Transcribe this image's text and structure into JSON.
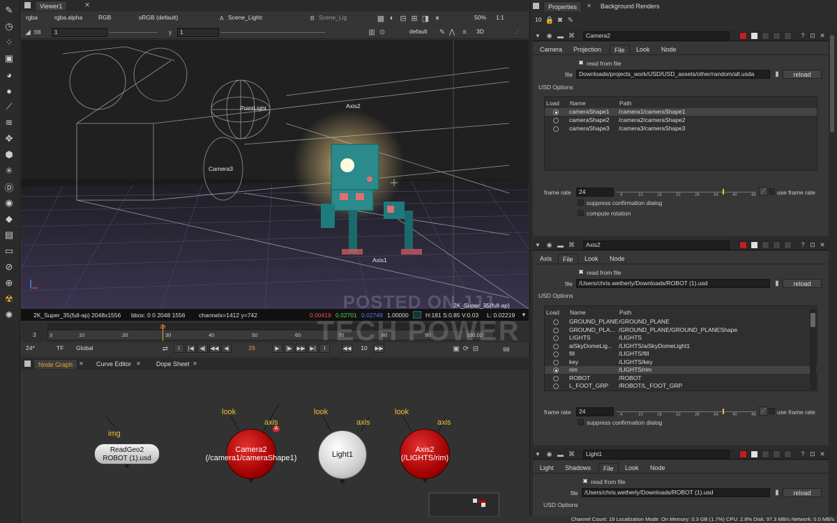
{
  "viewer": {
    "tab": "Viewer1",
    "channels": "rgba",
    "alpha": "rgba.alpha",
    "rgb": "RGB",
    "colorspace": "sRGB (default)",
    "input_a_letter": "A",
    "input_a": "Scene_Lights",
    "input_b_letter": "B",
    "input_b": "Scene_Lig",
    "zoom": "50%",
    "ratio": "1:1",
    "fstop": "f/8",
    "gain": "1",
    "gamma_label": "y",
    "gamma": "1",
    "lut": "default",
    "view_mode": "3D",
    "labels": {
      "pointlight": "PointLight",
      "axis2": "Axis2",
      "camera3": "Camera3",
      "axis1": "Axis1",
      "format": "2K_Super_35(full-ap)"
    },
    "info": {
      "format": "2K_Super_35(full-ap) 2048x1556",
      "bbox": "bbox: 0 0 2048 1556",
      "channel": "channel:",
      "coords": "x=1412 y=742",
      "r": "0.00419",
      "g": "0.02701",
      "b": "0.02749",
      "a": "1.00000",
      "hsv": "H:181 S:0.85 V:0.03",
      "l": "L: 0.02219",
      "colors": {
        "r": "#ff4b4b",
        "g": "#52d952",
        "b": "#5a78ff",
        "a": "#ffffff"
      }
    }
  },
  "timeline": {
    "frame_start": "3",
    "frame_end": "98",
    "current": "29",
    "step": "10",
    "fps": "24*",
    "tf": "TF",
    "scope": "Global",
    "ticks": [
      "3",
      "10",
      "20",
      "30",
      "40",
      "50",
      "60",
      "70",
      "80",
      "90",
      "100"
    ],
    "marker": "29",
    "end_marker": "100.02"
  },
  "bottom_tabs": [
    "Node Graph",
    "Curve Editor",
    "Dope Sheet"
  ],
  "nodes": {
    "readgeo": {
      "line1": "ReadGeo2",
      "line2": "ROBOT (1).usd",
      "input": "img"
    },
    "camera": {
      "line1": "Camera2",
      "line2": "(/camera1/cameraShape1)",
      "look": "look",
      "axis": "axis",
      "badge": "A"
    },
    "light": {
      "line1": "Light1",
      "look": "look",
      "axis": "axis"
    },
    "axis": {
      "line1": "Axis2",
      "line2": "(/LIGHTS/rim)",
      "look": "look",
      "axis": "axis"
    }
  },
  "properties": {
    "tabs": [
      "Properties",
      "Background Renders"
    ],
    "max_panels": "10",
    "camera_panel": {
      "name": "Camera2",
      "tabs": [
        "Camera",
        "Projection",
        "File",
        "Look",
        "Node"
      ],
      "active_tab": "File",
      "read_from_file": "read from file",
      "file_label": "file",
      "file_path": "Downloads/projects_work/USD/USD_assets/other/random/all.usda",
      "reload": "reload",
      "usd_options": "USD Options",
      "col_load": "Load",
      "col_name": "Name",
      "col_path": "Path",
      "rows": [
        {
          "name": "cameraShape1",
          "path": "/camera1/cameraShape1",
          "on": true
        },
        {
          "name": "cameraShape2",
          "path": "/camera2/cameraShape2",
          "on": false
        },
        {
          "name": "cameraShape3",
          "path": "/camera3/cameraShape3",
          "on": false
        }
      ],
      "frame_rate_label": "frame rate",
      "frame_rate": "24",
      "slider_ticks": [
        "4",
        "10",
        "16",
        "22",
        "28",
        "34",
        "40",
        "46"
      ],
      "use_frame_rate": "use frame rate",
      "suppress": "suppress confirmation dialog",
      "compute_rotation": "compute rotation"
    },
    "axis_panel": {
      "name": "Axis2",
      "tabs": [
        "Axis",
        "File",
        "Look",
        "Node"
      ],
      "active_tab": "File",
      "read_from_file": "read from file",
      "file_label": "file",
      "file_path": "/Users/chris.wetherly/Downloads/ROBOT (1).usd",
      "reload": "reload",
      "usd_options": "USD Options",
      "col_load": "Load",
      "col_name": "Name",
      "col_path": "Path",
      "rows": [
        {
          "name": "GROUND_PLANE",
          "path": "/GROUND_PLANE",
          "on": false
        },
        {
          "name": "GROUND_PLA...",
          "path": "/GROUND_PLANE/GROUND_PLANEShape",
          "on": false
        },
        {
          "name": "LIGHTS",
          "path": "/LIGHTS",
          "on": false
        },
        {
          "name": "aiSkyDomeLig...",
          "path": "/LIGHTS/aiSkyDomeLight1",
          "on": false
        },
        {
          "name": "fill",
          "path": "/LIGHTS/fill",
          "on": false
        },
        {
          "name": "key",
          "path": "/LIGHTS/key",
          "on": false
        },
        {
          "name": "rim",
          "path": "/LIGHTS/rim",
          "on": true
        },
        {
          "name": "ROBOT",
          "path": "/ROBOT",
          "on": false
        },
        {
          "name": "L_FOOT_GRP",
          "path": "/ROBOT/L_FOOT_GRP",
          "on": false
        }
      ],
      "frame_rate_label": "frame rate",
      "frame_rate": "24",
      "slider_ticks": [
        "4",
        "10",
        "16",
        "22",
        "28",
        "34",
        "40",
        "46"
      ],
      "use_frame_rate": "use frame rate",
      "suppress": "suppress confirmation dialog"
    },
    "light_panel": {
      "name": "Light1",
      "tabs": [
        "Light",
        "Shadows",
        "File",
        "Look",
        "Node"
      ],
      "active_tab": "File",
      "read_from_file": "read from file",
      "file_label": "file",
      "file_path": "/Users/chris.wetherly/Downloads/ROBOT (1).usd",
      "reload": "reload",
      "usd_options": "USD Options"
    }
  },
  "watermark": {
    "line1": "POSTED ON JJJ",
    "line2": "TECH POWER"
  },
  "status_bar": "Channel Count: 19  Localization Mode: On  Memory: 0.3 GB (1.7%)  CPU: 2.8%  Disk: 97.3 MB/s  Network: 0.0 MB/s",
  "icons": [
    "paint-brush-icon",
    "clock-icon",
    "dots-icon",
    "pie-icon",
    "circle-icon",
    "color-picker-icon",
    "layers-icon",
    "move-icon",
    "cube-icon",
    "asterisk-icon",
    "d-icon",
    "eye-icon",
    "tag-icon",
    "film-icon",
    "compass-icon",
    "globe-icon",
    "hazard-icon",
    "nuke-icon"
  ]
}
